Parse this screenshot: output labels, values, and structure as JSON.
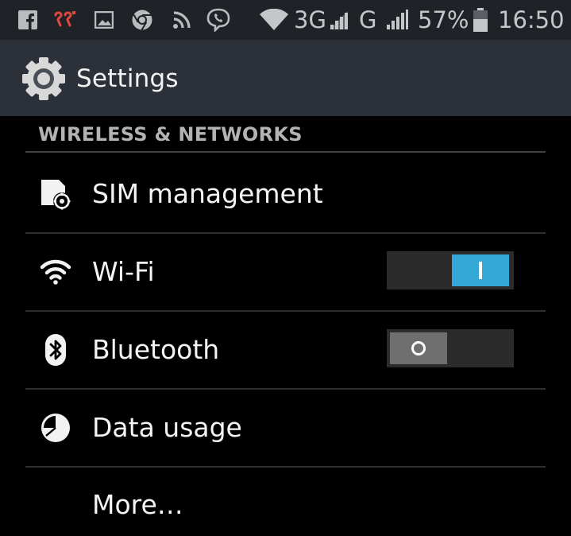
{
  "status_bar": {
    "icons": [
      "facebook-icon",
      "notification-app-icon",
      "gallery-icon",
      "chrome-icon",
      "rss-icon",
      "viber-icon",
      "wifi-icon",
      "signal-icon",
      "signal-icon",
      "battery-icon"
    ],
    "network_type_1": "3G",
    "network_type_2": "G",
    "battery_percent": "57%",
    "time": "16:50"
  },
  "action_bar": {
    "icon": "settings-gear-icon",
    "title": "Settings"
  },
  "section": {
    "title": "WIRELESS & NETWORKS"
  },
  "items": [
    {
      "label": "SIM management",
      "icon": "sim-management-icon"
    },
    {
      "label": "Wi-Fi",
      "icon": "wifi-icon",
      "toggle": "on"
    },
    {
      "label": "Bluetooth",
      "icon": "bluetooth-icon",
      "toggle": "off"
    },
    {
      "label": "Data usage",
      "icon": "data-usage-icon"
    },
    {
      "label": "More…"
    }
  ],
  "colors": {
    "status_bar_bg": "#1f2227",
    "action_bar_bg": "#2c3039",
    "background": "#000000",
    "switch_on": "#33a8d6",
    "switch_off": "#6f6f6f",
    "section_header": "#b3b3b3"
  }
}
